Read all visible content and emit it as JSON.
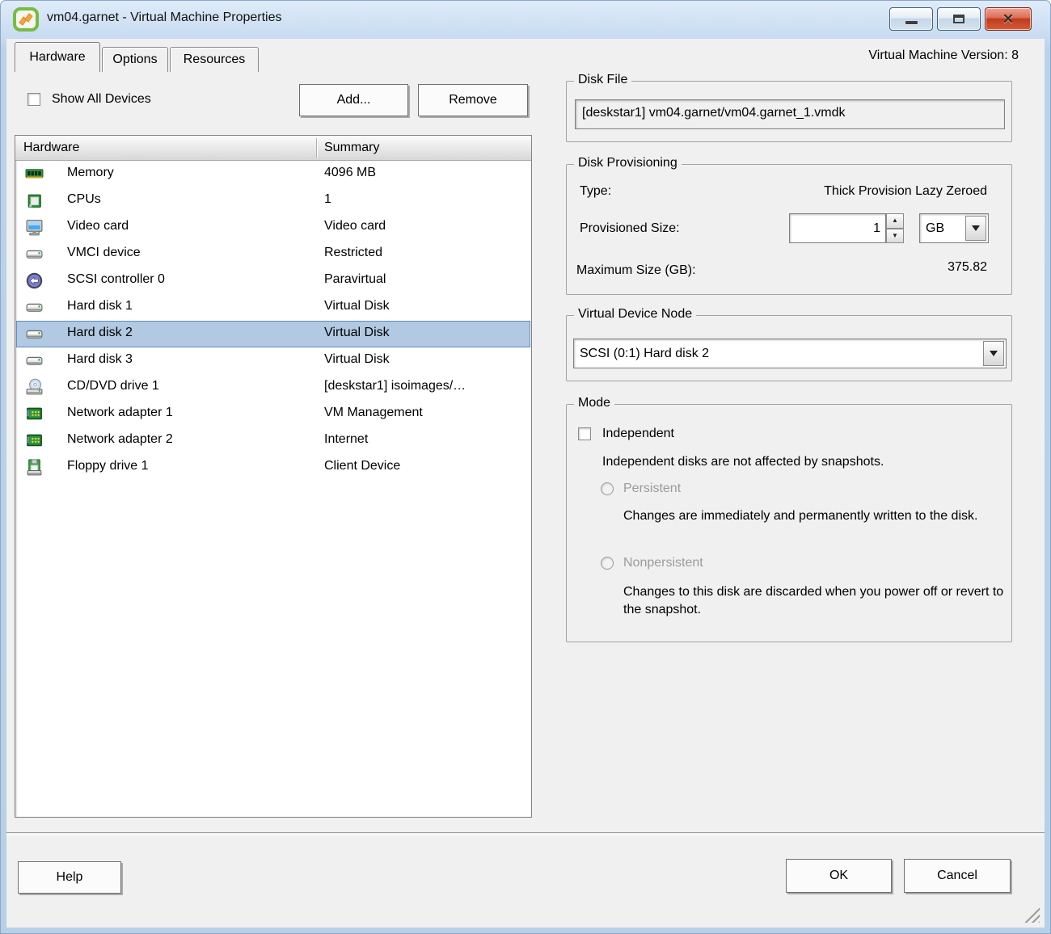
{
  "window": {
    "title": "vm04.garnet - Virtual Machine Properties",
    "version_label": "Virtual Machine Version: 8"
  },
  "tabs": [
    {
      "label": "Hardware",
      "active": true
    },
    {
      "label": "Options",
      "active": false
    },
    {
      "label": "Resources",
      "active": false
    }
  ],
  "toolbar": {
    "show_all_devices_label": "Show All Devices",
    "show_all_devices_checked": false,
    "add_label": "Add...",
    "remove_label": "Remove"
  },
  "hardware_table": {
    "columns": [
      "Hardware",
      "Summary"
    ],
    "rows": [
      {
        "icon": "memory-icon",
        "name": "Memory",
        "summary": "4096 MB",
        "selected": false
      },
      {
        "icon": "cpu-icon",
        "name": "CPUs",
        "summary": "1",
        "selected": false
      },
      {
        "icon": "video-card-icon",
        "name": "Video card",
        "summary": "Video card",
        "selected": false
      },
      {
        "icon": "vmci-device-icon",
        "name": "VMCI device",
        "summary": "Restricted",
        "selected": false
      },
      {
        "icon": "scsi-controller-icon",
        "name": "SCSI controller 0",
        "summary": "Paravirtual",
        "selected": false
      },
      {
        "icon": "hard-disk-icon",
        "name": "Hard disk 1",
        "summary": "Virtual Disk",
        "selected": false
      },
      {
        "icon": "hard-disk-icon",
        "name": "Hard disk 2",
        "summary": "Virtual Disk",
        "selected": true
      },
      {
        "icon": "hard-disk-icon",
        "name": "Hard disk 3",
        "summary": "Virtual Disk",
        "selected": false
      },
      {
        "icon": "cd-dvd-icon",
        "name": "CD/DVD drive 1",
        "summary": "[deskstar1] isoimages/…",
        "selected": false
      },
      {
        "icon": "network-adapter-icon",
        "name": "Network adapter 1",
        "summary": "VM Management",
        "selected": false
      },
      {
        "icon": "network-adapter-icon",
        "name": "Network adapter 2",
        "summary": "Internet",
        "selected": false
      },
      {
        "icon": "floppy-drive-icon",
        "name": "Floppy drive 1",
        "summary": "Client Device",
        "selected": false
      }
    ]
  },
  "disk_file": {
    "legend": "Disk File",
    "path": "[deskstar1] vm04.garnet/vm04.garnet_1.vmdk"
  },
  "disk_provisioning": {
    "legend": "Disk Provisioning",
    "type_label": "Type:",
    "type_value": "Thick Provision Lazy Zeroed",
    "provisioned_size_label": "Provisioned Size:",
    "provisioned_size_value": "1",
    "unit_value": "GB",
    "max_size_label": "Maximum Size (GB):",
    "max_size_value": "375.82"
  },
  "virtual_device_node": {
    "legend": "Virtual Device Node",
    "value": "SCSI (0:1) Hard disk 2"
  },
  "mode": {
    "legend": "Mode",
    "independent_label": "Independent",
    "independent_checked": false,
    "independent_desc": "Independent disks are not affected by snapshots.",
    "persistent_label": "Persistent",
    "persistent_desc": "Changes are immediately and permanently written to the disk.",
    "nonpersistent_label": "Nonpersistent",
    "nonpersistent_desc": "Changes to this disk are discarded when you power off or revert to the snapshot."
  },
  "footer": {
    "help_label": "Help",
    "ok_label": "OK",
    "cancel_label": "Cancel"
  },
  "colors": {
    "selection_bg": "#b1c9e3",
    "selection_border": "#618dc0",
    "titlebar_blue": "#c8dbf1",
    "close_button_red": "#c03a20",
    "dialog_bg": "#f0f0f0"
  }
}
